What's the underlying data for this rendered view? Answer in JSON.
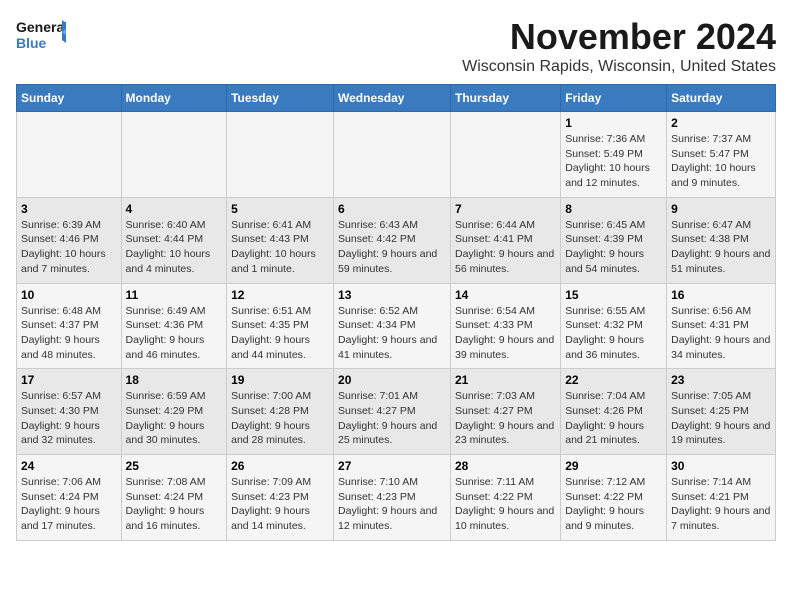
{
  "header": {
    "logo_line1": "General",
    "logo_line2": "Blue",
    "main_title": "November 2024",
    "subtitle": "Wisconsin Rapids, Wisconsin, United States"
  },
  "days_of_week": [
    "Sunday",
    "Monday",
    "Tuesday",
    "Wednesday",
    "Thursday",
    "Friday",
    "Saturday"
  ],
  "weeks": [
    [
      {
        "day": "",
        "info": ""
      },
      {
        "day": "",
        "info": ""
      },
      {
        "day": "",
        "info": ""
      },
      {
        "day": "",
        "info": ""
      },
      {
        "day": "",
        "info": ""
      },
      {
        "day": "1",
        "info": "Sunrise: 7:36 AM\nSunset: 5:49 PM\nDaylight: 10 hours and 12 minutes."
      },
      {
        "day": "2",
        "info": "Sunrise: 7:37 AM\nSunset: 5:47 PM\nDaylight: 10 hours and 9 minutes."
      }
    ],
    [
      {
        "day": "3",
        "info": "Sunrise: 6:39 AM\nSunset: 4:46 PM\nDaylight: 10 hours and 7 minutes."
      },
      {
        "day": "4",
        "info": "Sunrise: 6:40 AM\nSunset: 4:44 PM\nDaylight: 10 hours and 4 minutes."
      },
      {
        "day": "5",
        "info": "Sunrise: 6:41 AM\nSunset: 4:43 PM\nDaylight: 10 hours and 1 minute."
      },
      {
        "day": "6",
        "info": "Sunrise: 6:43 AM\nSunset: 4:42 PM\nDaylight: 9 hours and 59 minutes."
      },
      {
        "day": "7",
        "info": "Sunrise: 6:44 AM\nSunset: 4:41 PM\nDaylight: 9 hours and 56 minutes."
      },
      {
        "day": "8",
        "info": "Sunrise: 6:45 AM\nSunset: 4:39 PM\nDaylight: 9 hours and 54 minutes."
      },
      {
        "day": "9",
        "info": "Sunrise: 6:47 AM\nSunset: 4:38 PM\nDaylight: 9 hours and 51 minutes."
      }
    ],
    [
      {
        "day": "10",
        "info": "Sunrise: 6:48 AM\nSunset: 4:37 PM\nDaylight: 9 hours and 48 minutes."
      },
      {
        "day": "11",
        "info": "Sunrise: 6:49 AM\nSunset: 4:36 PM\nDaylight: 9 hours and 46 minutes."
      },
      {
        "day": "12",
        "info": "Sunrise: 6:51 AM\nSunset: 4:35 PM\nDaylight: 9 hours and 44 minutes."
      },
      {
        "day": "13",
        "info": "Sunrise: 6:52 AM\nSunset: 4:34 PM\nDaylight: 9 hours and 41 minutes."
      },
      {
        "day": "14",
        "info": "Sunrise: 6:54 AM\nSunset: 4:33 PM\nDaylight: 9 hours and 39 minutes."
      },
      {
        "day": "15",
        "info": "Sunrise: 6:55 AM\nSunset: 4:32 PM\nDaylight: 9 hours and 36 minutes."
      },
      {
        "day": "16",
        "info": "Sunrise: 6:56 AM\nSunset: 4:31 PM\nDaylight: 9 hours and 34 minutes."
      }
    ],
    [
      {
        "day": "17",
        "info": "Sunrise: 6:57 AM\nSunset: 4:30 PM\nDaylight: 9 hours and 32 minutes."
      },
      {
        "day": "18",
        "info": "Sunrise: 6:59 AM\nSunset: 4:29 PM\nDaylight: 9 hours and 30 minutes."
      },
      {
        "day": "19",
        "info": "Sunrise: 7:00 AM\nSunset: 4:28 PM\nDaylight: 9 hours and 28 minutes."
      },
      {
        "day": "20",
        "info": "Sunrise: 7:01 AM\nSunset: 4:27 PM\nDaylight: 9 hours and 25 minutes."
      },
      {
        "day": "21",
        "info": "Sunrise: 7:03 AM\nSunset: 4:27 PM\nDaylight: 9 hours and 23 minutes."
      },
      {
        "day": "22",
        "info": "Sunrise: 7:04 AM\nSunset: 4:26 PM\nDaylight: 9 hours and 21 minutes."
      },
      {
        "day": "23",
        "info": "Sunrise: 7:05 AM\nSunset: 4:25 PM\nDaylight: 9 hours and 19 minutes."
      }
    ],
    [
      {
        "day": "24",
        "info": "Sunrise: 7:06 AM\nSunset: 4:24 PM\nDaylight: 9 hours and 17 minutes."
      },
      {
        "day": "25",
        "info": "Sunrise: 7:08 AM\nSunset: 4:24 PM\nDaylight: 9 hours and 16 minutes."
      },
      {
        "day": "26",
        "info": "Sunrise: 7:09 AM\nSunset: 4:23 PM\nDaylight: 9 hours and 14 minutes."
      },
      {
        "day": "27",
        "info": "Sunrise: 7:10 AM\nSunset: 4:23 PM\nDaylight: 9 hours and 12 minutes."
      },
      {
        "day": "28",
        "info": "Sunrise: 7:11 AM\nSunset: 4:22 PM\nDaylight: 9 hours and 10 minutes."
      },
      {
        "day": "29",
        "info": "Sunrise: 7:12 AM\nSunset: 4:22 PM\nDaylight: 9 hours and 9 minutes."
      },
      {
        "day": "30",
        "info": "Sunrise: 7:14 AM\nSunset: 4:21 PM\nDaylight: 9 hours and 7 minutes."
      }
    ]
  ]
}
